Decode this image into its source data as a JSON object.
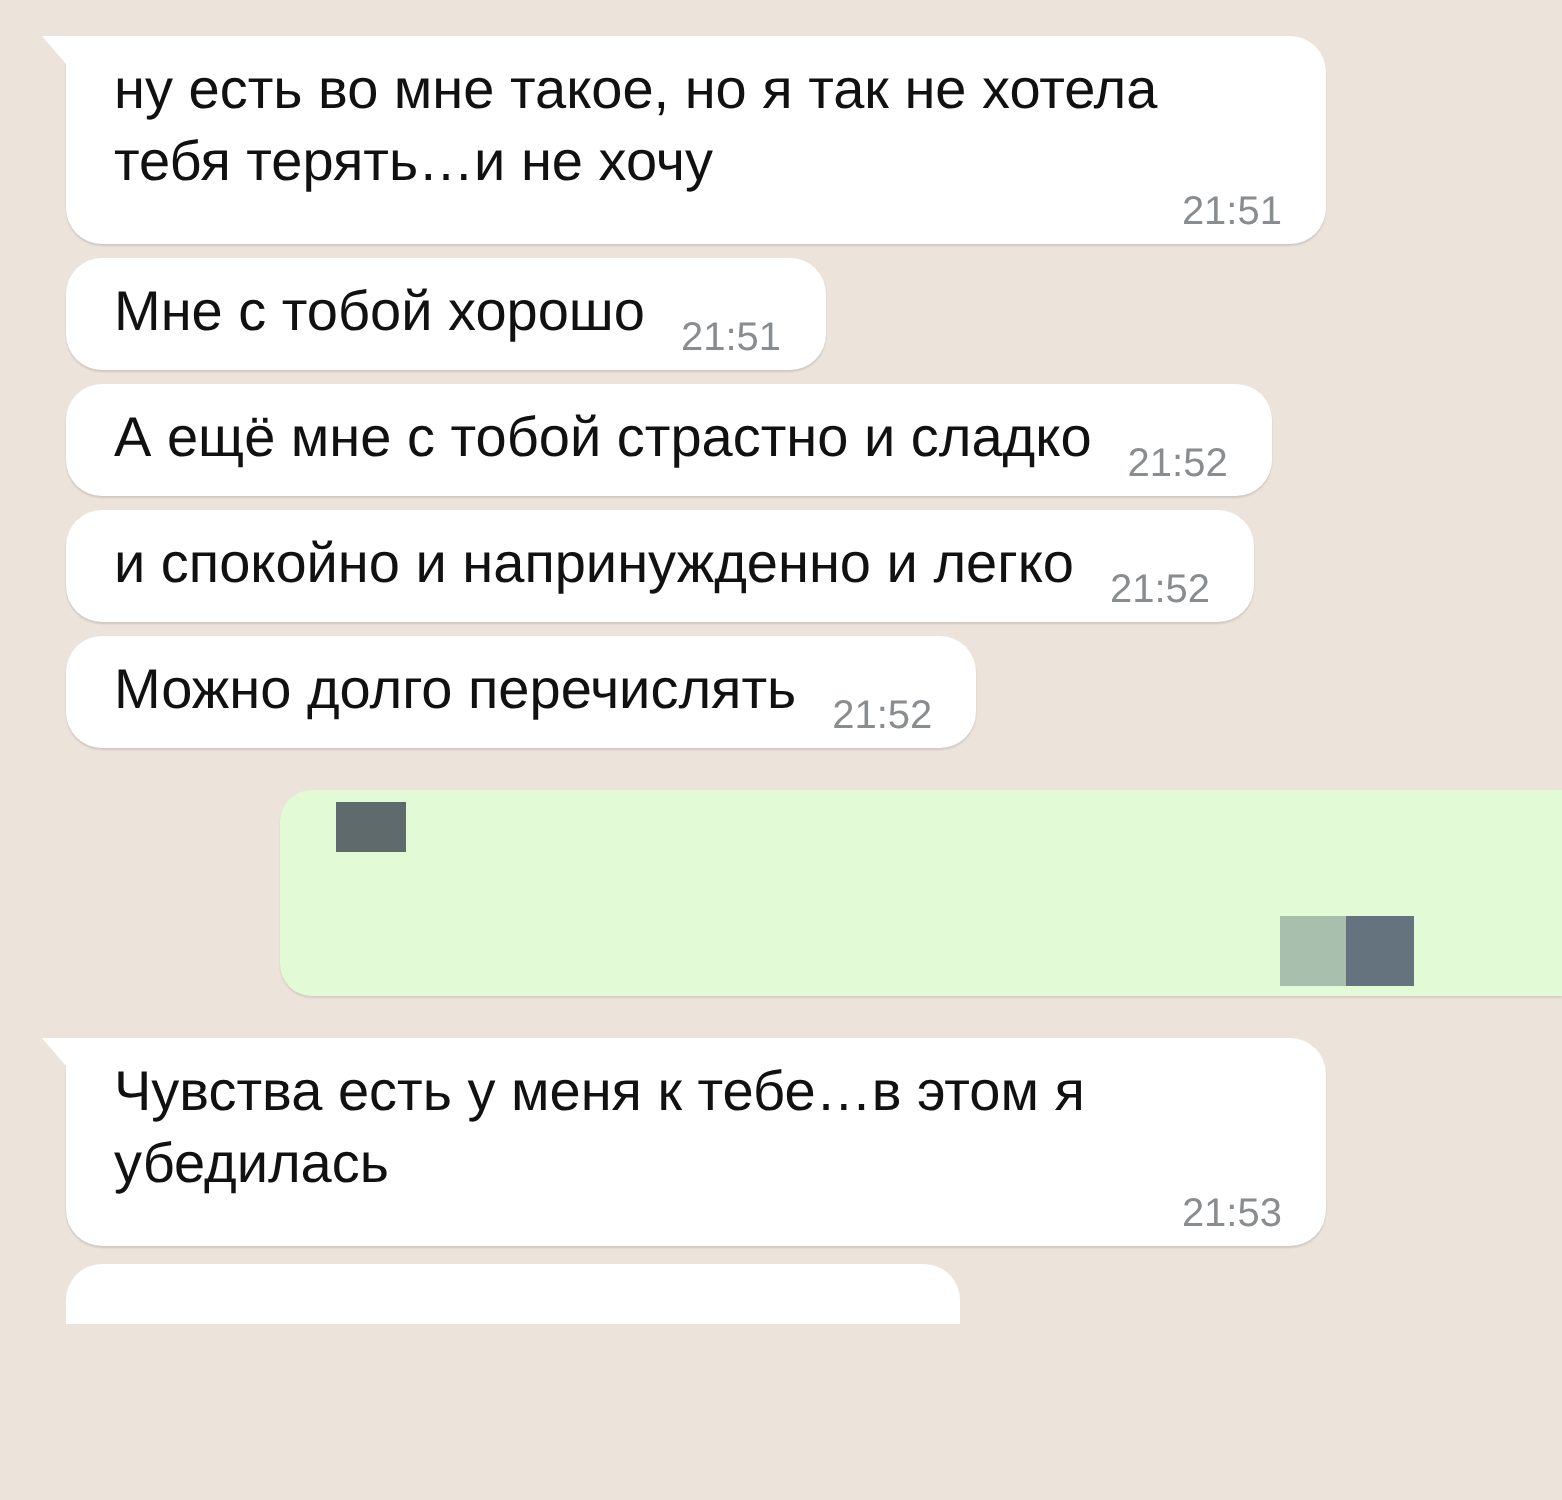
{
  "messages": [
    {
      "kind": "incoming",
      "text": "ну есть во мне такое, но я так не хотела тебя терять…и не хочу",
      "time": "21:51"
    },
    {
      "kind": "incoming",
      "text": "Мне с тобой хорошо",
      "time": "21:51"
    },
    {
      "kind": "incoming",
      "text": "А ещё мне с тобой страстно и сладко",
      "time": "21:52"
    },
    {
      "kind": "incoming",
      "text": "и спокойно и напринужденно и легко",
      "time": "21:52"
    },
    {
      "kind": "incoming",
      "text": "Можно долго перечислять",
      "time": "21:52"
    },
    {
      "kind": "redacted"
    },
    {
      "kind": "incoming",
      "text": "Чувства есть у меня к тебе…в этом я убедилась",
      "time": "21:53"
    },
    {
      "kind": "partial"
    }
  ]
}
